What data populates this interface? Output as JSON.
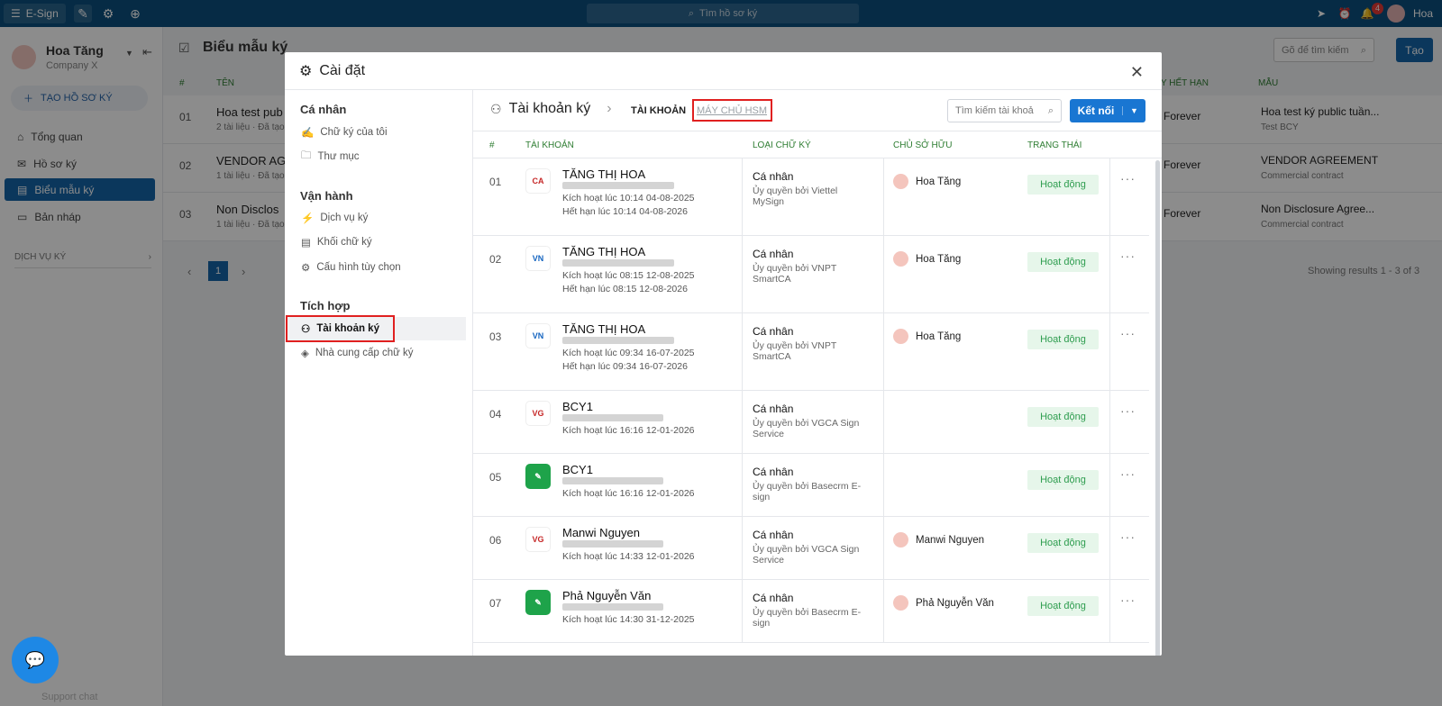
{
  "topbar": {
    "app_name": "E-Sign",
    "search_placeholder": "Tìm hồ sơ ký",
    "notif_count": "4",
    "user_short": "Hoa"
  },
  "sidebar": {
    "user_name": "Hoa Tăng",
    "company": "Company X",
    "create_label": "TẠO HỒ SƠ KÝ",
    "items": [
      {
        "label": "Tổng quan"
      },
      {
        "label": "Hồ sơ ký"
      },
      {
        "label": "Biểu mẫu ký"
      },
      {
        "label": "Bản nháp"
      }
    ],
    "section": "DỊCH VỤ KÝ"
  },
  "main": {
    "title": "Biểu mẫu ký",
    "search_placeholder": "Gõ để tìm kiếm",
    "create_label": "Tạo",
    "col_num": "#",
    "col_name": "TÊN",
    "col_expiry": "Y HẾT HẠN",
    "col_template": "MẪU",
    "rows": [
      {
        "num": "01",
        "name": "Hoa test pub",
        "sub": "2 tài liệu · Đã tạo",
        "expiry": "Forever",
        "template": "Hoa test ký public tuần...",
        "template_sub": "Test BCY"
      },
      {
        "num": "02",
        "name": "VENDOR AG",
        "sub": "1 tài liệu · Đã tạo",
        "expiry": "Forever",
        "template": "VENDOR AGREEMENT",
        "template_sub": "Commercial contract"
      },
      {
        "num": "03",
        "name": "Non Disclos",
        "sub": "1 tài liệu · Đã tạo",
        "expiry": "Forever",
        "template": "Non Disclosure Agree...",
        "template_sub": "Commercial contract"
      }
    ],
    "page": "1",
    "showing": "Showing results 1 - 3 of 3"
  },
  "modal": {
    "title": "Cài đặt",
    "sections": [
      {
        "title": "Cá nhân",
        "items": [
          "Chữ ký của tôi",
          "Thư mục"
        ]
      },
      {
        "title": "Vận hành",
        "items": [
          "Dịch vụ ký",
          "Khối chữ ký",
          "Cấu hình tùy chọn"
        ]
      },
      {
        "title": "Tích hợp",
        "items": [
          "Tài khoản ký",
          "Nhà cung cấp chữ ký"
        ]
      }
    ],
    "right_title": "Tài khoản ký",
    "crumb_active": "TÀI KHOẢN",
    "crumb_other": "MÁY CHỦ HSM",
    "search_placeholder": "Tìm kiếm tài khoả",
    "connect_label": "Kết nối",
    "headers": {
      "num": "#",
      "account": "TÀI KHOẢN",
      "type": "LOẠI CHỮ KÝ",
      "owner": "CHỦ SỞ HỮU",
      "status": "TRẠNG THÁI"
    },
    "rows": [
      {
        "num": "01",
        "name": "TĂNG THỊ HOA",
        "lines": [
          "Kích hoạt lúc 10:14 04-08-2025",
          "Hết hạn lúc 10:14 04-08-2026"
        ],
        "type": "Cá nhân",
        "sub": "Ủy quyền bởi Viettel MySign",
        "owner": "Hoa Tăng",
        "status": "Hoạt động",
        "logo": "CA"
      },
      {
        "num": "02",
        "name": "TĂNG THỊ HOA",
        "lines": [
          "Kích hoạt lúc 08:15 12-08-2025",
          "Hết hạn lúc 08:15 12-08-2026"
        ],
        "type": "Cá nhân",
        "sub": "Ủy quyền bởi VNPT SmartCA",
        "owner": "Hoa Tăng",
        "status": "Hoạt động",
        "logo": "VNPT"
      },
      {
        "num": "03",
        "name": "TĂNG THỊ HOA",
        "lines": [
          "Kích hoạt lúc 09:34 16-07-2025",
          "Hết hạn lúc 09:34 16-07-2026"
        ],
        "type": "Cá nhân",
        "sub": "Ủy quyền bởi VNPT SmartCA",
        "owner": "Hoa Tăng",
        "status": "Hoạt động",
        "logo": "VNPT"
      },
      {
        "num": "04",
        "name": "BCY1",
        "lines": [
          "Kích hoạt lúc 16:16 12-01-2026"
        ],
        "type": "Cá nhân",
        "sub": "Ủy quyền bởi VGCA Sign Service",
        "owner": "",
        "status": "Hoạt động",
        "logo": "VGCA"
      },
      {
        "num": "05",
        "name": "BCY1",
        "lines": [
          "Kích hoạt lúc 16:16 12-01-2026"
        ],
        "type": "Cá nhân",
        "sub": "Ủy quyền bởi Basecrm E-sign",
        "owner": "",
        "status": "Hoạt động",
        "logo": "BASE"
      },
      {
        "num": "06",
        "name": "Manwi Nguyen",
        "lines": [
          "Kích hoạt lúc 14:33 12-01-2026"
        ],
        "type": "Cá nhân",
        "sub": "Ủy quyền bởi VGCA Sign Service",
        "owner": "Manwi Nguyen",
        "status": "Hoạt động",
        "logo": "VGCA"
      },
      {
        "num": "07",
        "name": "Phả Nguyễn Văn",
        "lines": [
          "Kích hoạt lúc 14:30 31-12-2025"
        ],
        "type": "Cá nhân",
        "sub": "Ủy quyền bởi Basecrm E-sign",
        "owner": "Phả Nguyễn Văn",
        "status": "Hoạt động",
        "logo": "BASE"
      }
    ]
  },
  "support": {
    "label": "Support chat"
  }
}
